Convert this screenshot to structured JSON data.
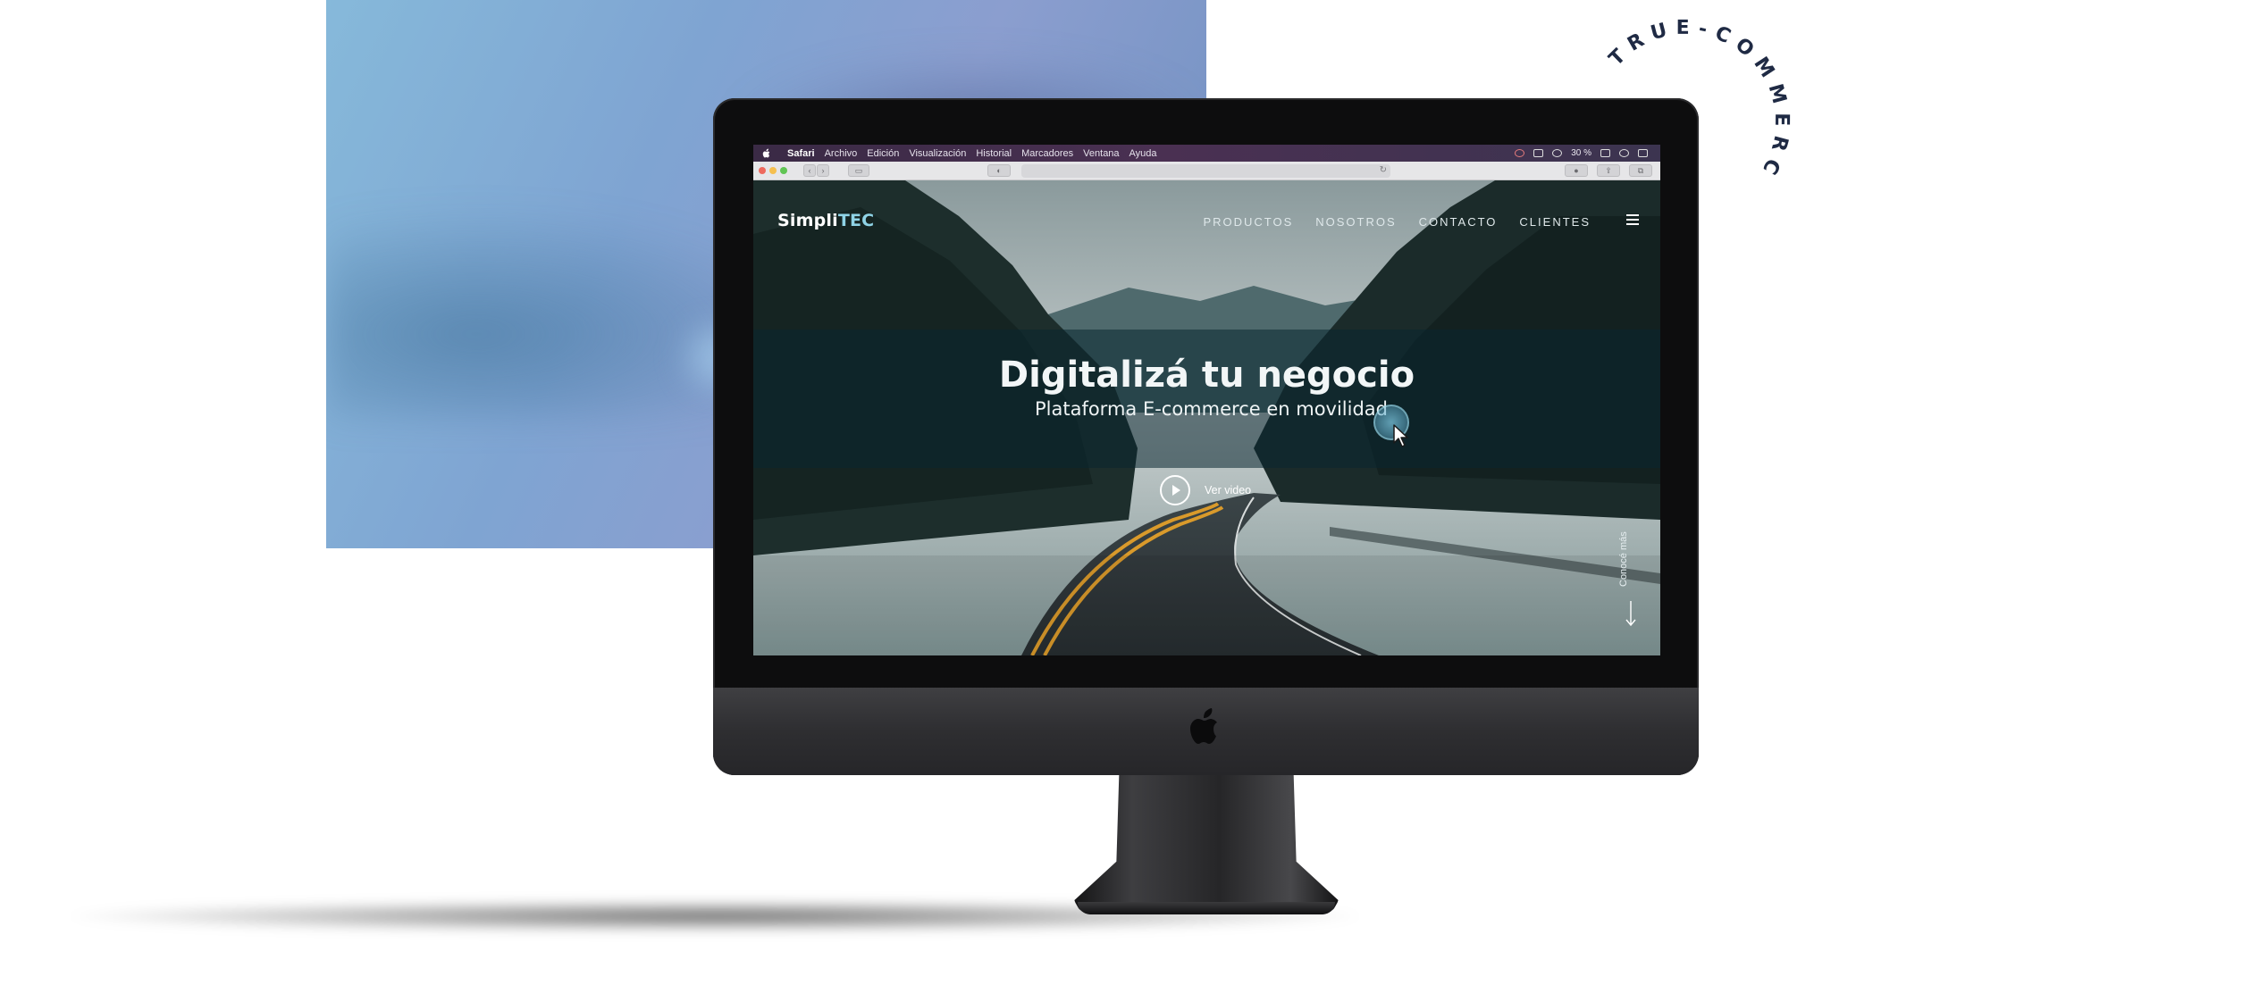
{
  "badge": {
    "curved_text": "TRUE-COMMERCE"
  },
  "macos": {
    "menubar": {
      "app": "Safari",
      "items": [
        "Archivo",
        "Edición",
        "Visualización",
        "Historial",
        "Marcadores",
        "Ventana",
        "Ayuda"
      ],
      "battery": "30 %"
    }
  },
  "site": {
    "logo_part1": "Simpli",
    "logo_part2": "TEC",
    "nav": [
      "PRODUCTOS",
      "NOSOTROS",
      "CONTACTO",
      "CLIENTES"
    ],
    "hero": {
      "title": "Digitalizá tu negocio",
      "subtitle": "Plataforma E-commerce en movilidad",
      "video_label": "Ver video"
    },
    "scroll_hint": "Conocé más"
  },
  "colors": {
    "accent": "#8fd3e6",
    "menubar": "#4a3052",
    "monitor": "#0d0d0e",
    "panel": "#86b9da"
  }
}
